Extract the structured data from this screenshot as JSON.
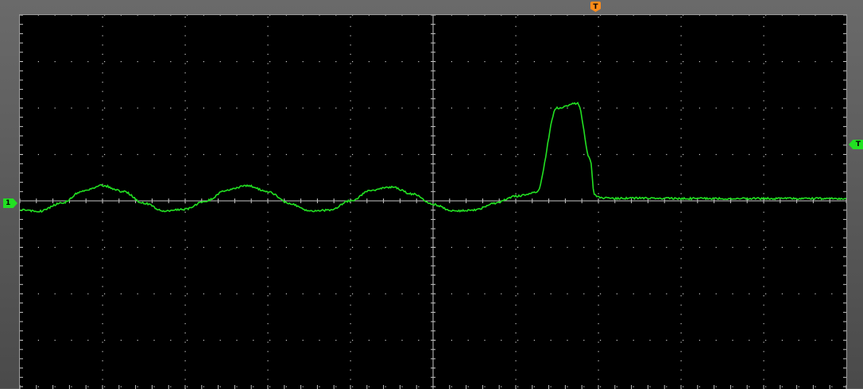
{
  "markers": {
    "trigger_position": "T",
    "channel1_ground": "1",
    "trigger_level": "T"
  },
  "colors": {
    "screen": "#000000",
    "graticule": "#c8c8c8",
    "trace": "#22e022",
    "trigger_marker": "#ff8c1a"
  },
  "icons": [
    "trigger-position-icon",
    "channel1-ground-icon",
    "trigger-level-icon"
  ],
  "chart_data": {
    "type": "line",
    "title": "",
    "xlabel": "",
    "ylabel": "",
    "grid": true,
    "divisions": {
      "x": 10,
      "y": 8
    },
    "xlim": [
      0,
      10
    ],
    "ylim": [
      -4,
      4
    ],
    "series": [
      {
        "x": [
          0,
          0.25,
          0.5,
          0.75,
          1.0,
          1.25,
          1.5,
          1.75,
          2.0,
          2.25,
          2.5,
          2.75,
          3.0,
          3.25,
          3.5,
          3.75,
          4.0,
          4.25,
          4.5,
          4.75,
          5.0,
          5.25,
          5.5,
          5.75,
          6.0,
          6.25,
          6.5,
          6.75,
          6.9,
          6.95,
          6.97,
          6.98,
          6.99,
          7.0,
          7.01,
          7.02,
          7.05,
          7.2,
          7.5,
          8.0,
          8.5,
          9.0,
          9.5,
          10.0
        ],
        "y": [
          -0.2,
          -0.22,
          -0.05,
          0.2,
          0.33,
          0.2,
          -0.05,
          -0.22,
          -0.18,
          0.0,
          0.23,
          0.33,
          0.2,
          -0.05,
          -0.22,
          -0.2,
          0.0,
          0.23,
          0.3,
          0.15,
          -0.08,
          -0.22,
          -0.2,
          -0.05,
          0.1,
          0.18,
          2.0,
          2.1,
          0.9,
          0.15,
          0.12,
          0.1,
          0.08,
          0.08,
          0.07,
          0.06,
          0.06,
          0.05,
          0.06,
          0.05,
          0.05,
          0.05,
          0.05,
          0.05
        ]
      }
    ]
  }
}
